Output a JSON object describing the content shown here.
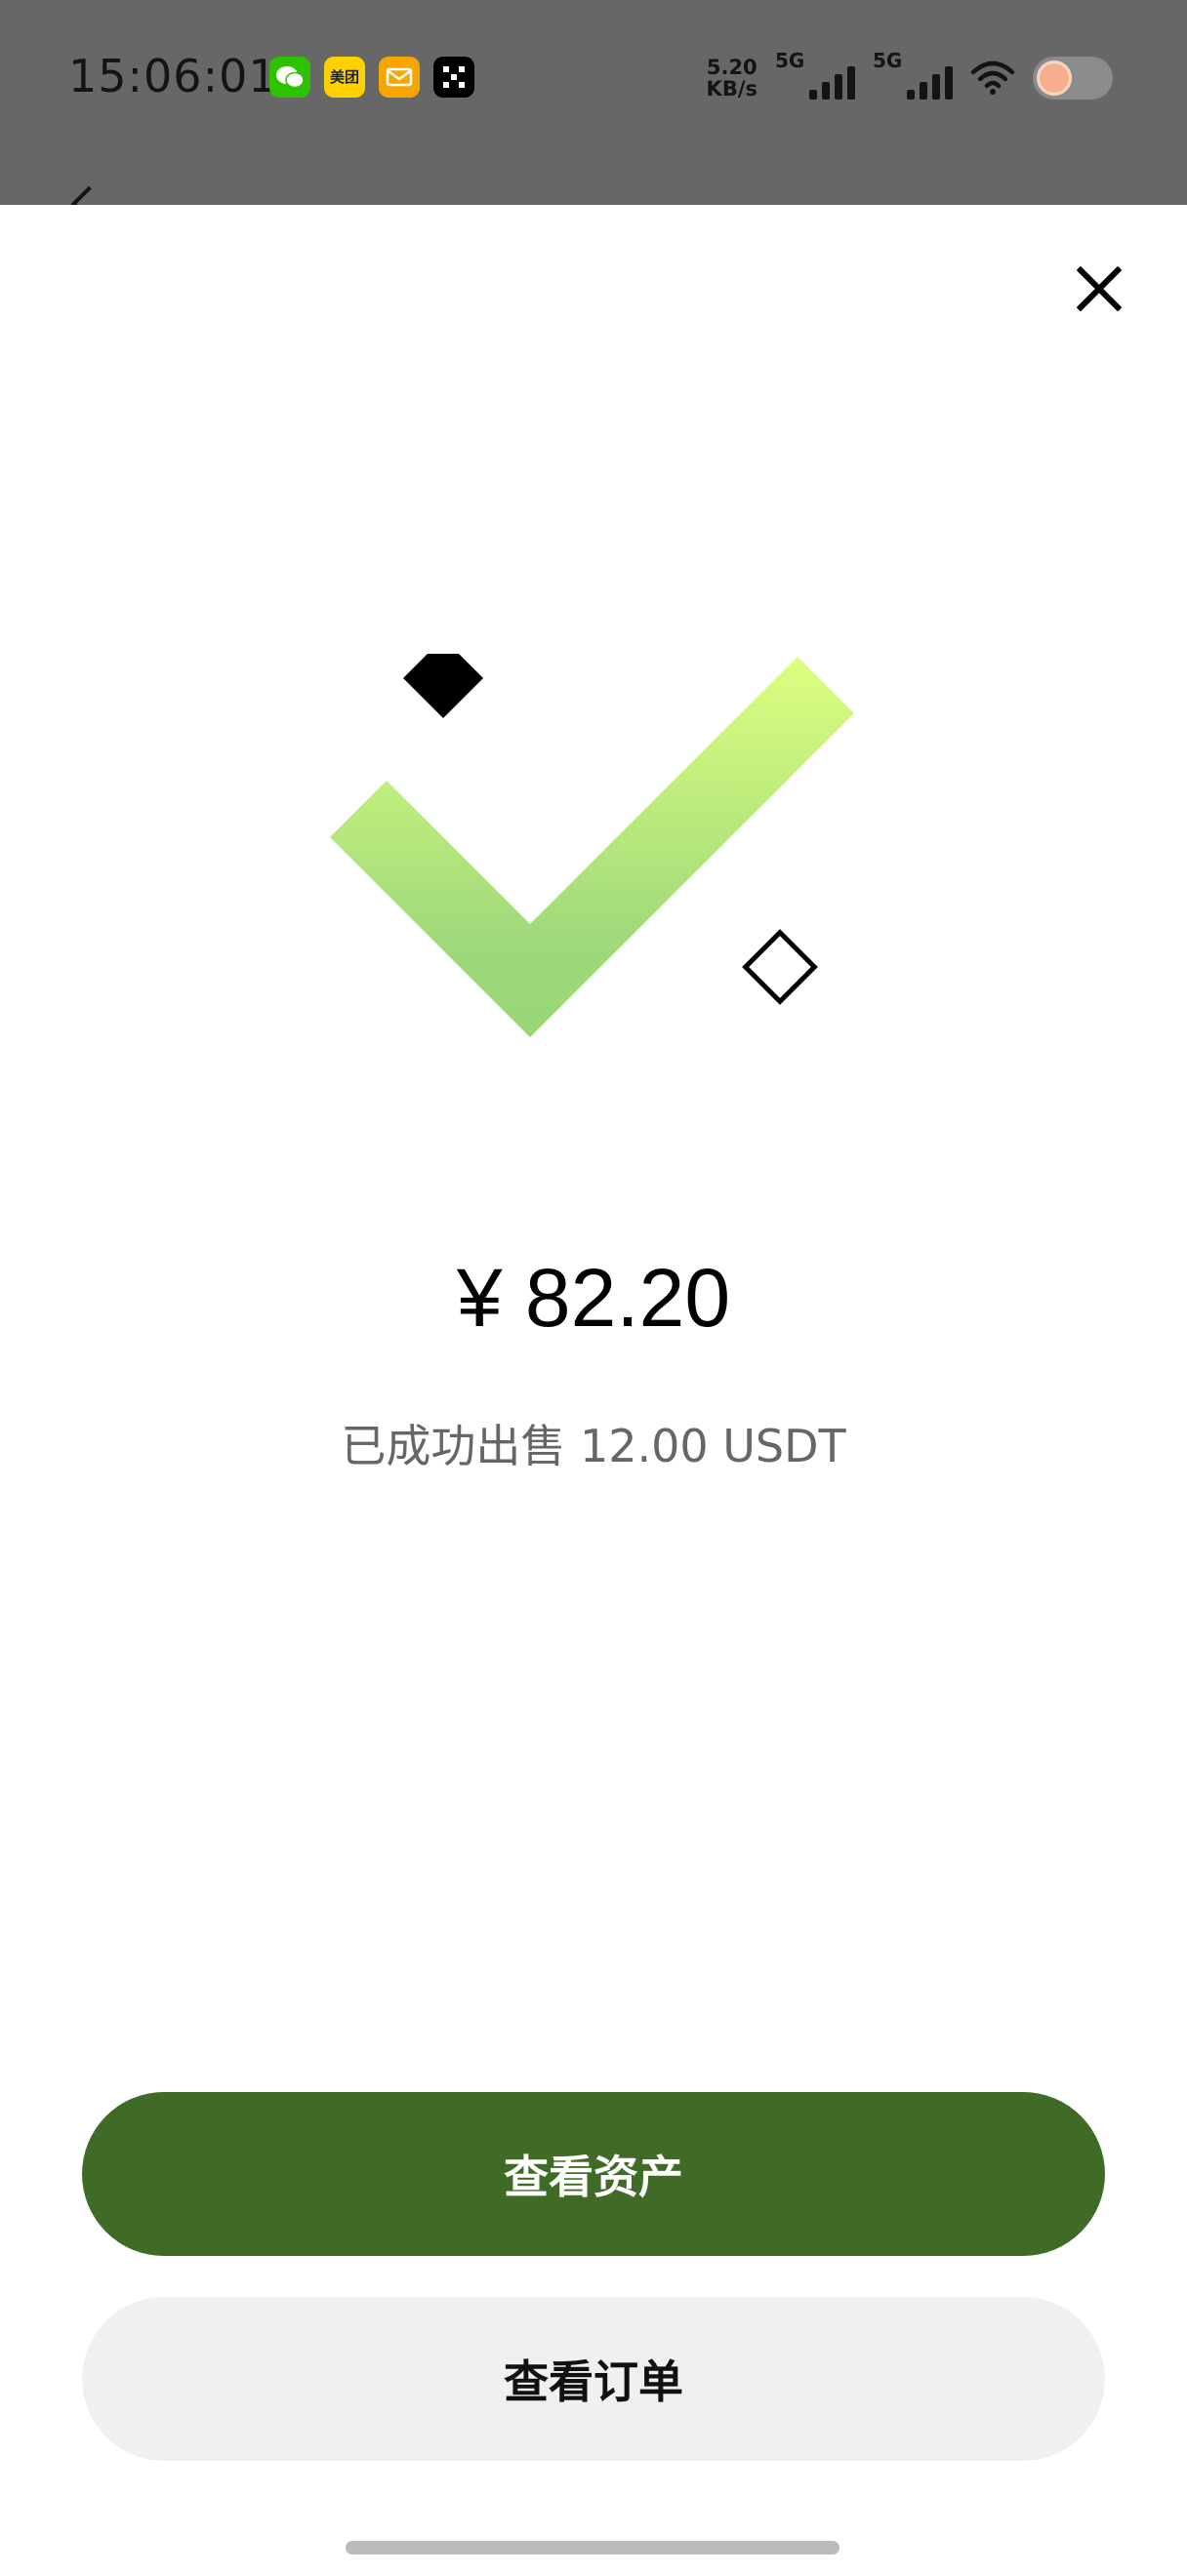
{
  "status_bar": {
    "time": "15:06:01",
    "notification_icons": [
      "wechat-icon",
      "meituan-icon",
      "mail-icon",
      "okx-icon"
    ],
    "meituan_label": "美团",
    "net_speed_value": "5.20",
    "net_speed_unit": "KB/s",
    "signal_1_label": "5G",
    "signal_2_label": "5G"
  },
  "result": {
    "amount": "¥ 82.20",
    "message": "已成功出售 12.00 USDT"
  },
  "actions": {
    "primary_label": "查看资产",
    "secondary_label": "查看订单"
  },
  "colors": {
    "primary_button": "#3f6b27",
    "secondary_button": "#f0f0f0",
    "check_gradient_top": "#ddff7f",
    "check_gradient_bottom": "#97d877",
    "status_bar_bg": "#676767"
  }
}
